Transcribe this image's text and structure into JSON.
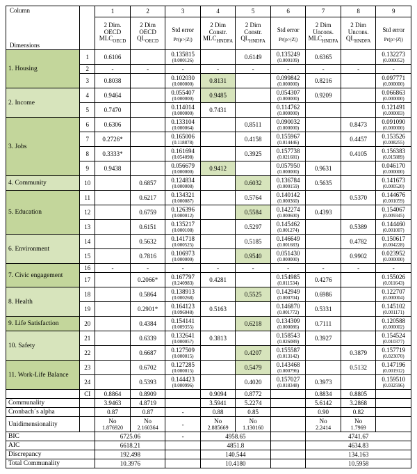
{
  "columns": {
    "nums": [
      "1",
      "2",
      "3",
      "4",
      "5",
      "6",
      "7",
      "8",
      "9"
    ],
    "left_top": "Column",
    "left_bottom": "Dimensions",
    "c1": {
      "a": "2 Dim.",
      "b": "OECD",
      "c": "MLC",
      "d": "OECD"
    },
    "c2": {
      "a": "2 Dim",
      "b": "OECD",
      "c": "QL",
      "d": "OECD"
    },
    "c3": {
      "a": "Std error",
      "b": "Pr(p>|Z|)"
    },
    "c4": {
      "a": "2 Dim",
      "b": "Constr.",
      "c": "MLC",
      "d": "HNDFA"
    },
    "c5": {
      "a": "2 Dim",
      "b": "Constr.",
      "c": "QL",
      "d": "HNDFA"
    },
    "c6": {
      "a": "Std error",
      "b": "Pr(p>|Z|)"
    },
    "c7": {
      "a": "2 Dim",
      "b": "Uncons.",
      "c": "MLC",
      "d": "HNDFA"
    },
    "c8": {
      "a": "2 Dim",
      "b": "Uncons.",
      "c": "QL",
      "d": "HNDFA"
    },
    "c9": {
      "a": "Std error",
      "b": "Pr(p>|Z|)"
    }
  },
  "dims": [
    {
      "name": "1. Housing",
      "cls": "dim-olive",
      "rows": [
        {
          "idx": "1",
          "c1": "0.6106",
          "c2": "",
          "c3": {
            "m": "0.135815",
            "s": "(0.000126)"
          },
          "c4": "",
          "c5": "0.6149",
          "c6": {
            "m": "0.135249",
            "s": "(0.000109)"
          },
          "c7": "0.6365",
          "c8": "",
          "c9": {
            "m": "0.132273",
            "s": "(0.000052)"
          }
        },
        {
          "idx": "2",
          "c1": "-",
          "c2": "-",
          "c3": "-",
          "c4": "-",
          "c5": "-",
          "c6": "-",
          "c7": "-",
          "c8": "-",
          "c9": "-"
        },
        {
          "idx": "3",
          "c1": "0.8038",
          "c2": "",
          "c3": {
            "m": "0.102030",
            "s": "(0.000000)"
          },
          "c4": "0.8131",
          "hl4": true,
          "c5": "",
          "c6": {
            "m": "0.099842",
            "s": "(0.000000)"
          },
          "c7": "0.8216",
          "c8": "",
          "c9": {
            "m": "0.097771",
            "s": "(0.000000)"
          }
        }
      ]
    },
    {
      "name": "2. Income",
      "cls": "dim-green1",
      "rows": [
        {
          "idx": "4",
          "c1": "0.9464",
          "c2": "",
          "c3": {
            "m": "0.055407",
            "s": "(0.000000)"
          },
          "c4": "0.9485",
          "hl4": true,
          "c5": "",
          "c6": {
            "m": "0.054307",
            "s": "(0.000000)"
          },
          "c7": "0.9209",
          "c8": "",
          "c9": {
            "m": "0.066863",
            "s": "(0.000000)"
          }
        },
        {
          "idx": "5",
          "c1": "0.7470",
          "c2": "",
          "c3": {
            "m": "0.114014",
            "s": "(0.000000)"
          },
          "c4": "0.7431",
          "c5": "",
          "c6": {
            "m": "0.114762",
            "s": "(0.000000)"
          },
          "c7": "",
          "c8": "",
          "c9": {
            "m": "0.121491",
            "s": "(0.000003)"
          }
        }
      ]
    },
    {
      "name": "3. Jobs",
      "cls": "dim-olive",
      "rows": [
        {
          "idx": "6",
          "c1": "0.6306",
          "c2": "",
          "c3": {
            "m": "0.133104",
            "s": "(0.000064)"
          },
          "c4": "",
          "c5": "0.8511",
          "c6": {
            "m": "0.090032",
            "s": "(0.000000)"
          },
          "c7": "",
          "c8": "0.8473",
          "c9": {
            "m": "0.091090",
            "s": "(0.000000)"
          }
        },
        {
          "idx": "7",
          "c1": "0.2726*",
          "c2": "",
          "c3": {
            "m": "0.165006",
            "s": "(0.118878)"
          },
          "c4": "",
          "c5": "0.4158",
          "c6": {
            "m": "0.155967",
            "s": "(0.014446)"
          },
          "c7": "",
          "c8": "0.4457",
          "c9": {
            "m": "0.153526",
            "s": "(0.008255)"
          }
        },
        {
          "idx": "8",
          "c1": "0.3333*",
          "c2": "",
          "c3": {
            "m": "0.161694",
            "s": "(0.054098)"
          },
          "c4": "",
          "c5": "0.3925",
          "c6": {
            "m": "0.157738",
            "s": "(0.021681)"
          },
          "c7": "",
          "c8": "0.4105",
          "c9": {
            "m": "0.156383",
            "s": "(0.015889)"
          }
        },
        {
          "idx": "9",
          "c1": "0.9438",
          "c2": "",
          "c3": {
            "m": "0.056679",
            "s": "(0.000000)"
          },
          "c4": "0.9412",
          "hl4": true,
          "c5": "",
          "c6": {
            "m": "0.057950",
            "s": "(0.000000)"
          },
          "c7": "0.9631",
          "c8": "",
          "c9": {
            "m": "0.046170",
            "s": "(0.000000)"
          }
        }
      ]
    },
    {
      "name": "4. Community",
      "cls": "dim-green2",
      "rows": [
        {
          "idx": "10",
          "c1": "",
          "c2": "0.6857",
          "c3": {
            "m": "0.124834",
            "s": "(0.000008)"
          },
          "c4": "",
          "c5": "0.6032",
          "hl5": true,
          "c6": {
            "m": "0.136784",
            "s": "(0.000159)"
          },
          "c7": "0.5635",
          "c8": "",
          "c9": {
            "m": "0.141673",
            "s": "(0.000520)"
          }
        }
      ]
    },
    {
      "name": "5. Education",
      "cls": "dim-olive",
      "rows": [
        {
          "idx": "11",
          "c1": "",
          "c2": "0.6217",
          "c3": {
            "m": "0.134321",
            "s": "(0.000087)"
          },
          "c4": "",
          "c5": "0.5764",
          "c6": {
            "m": "0.140142",
            "s": "(0.000360)"
          },
          "c7": "",
          "c8": "0.5370",
          "c9": {
            "m": "0.144676",
            "s": "(0.001059)"
          }
        },
        {
          "idx": "12",
          "c1": "",
          "c2": "0.6759",
          "c3": {
            "m": "0.126396",
            "s": "(0.000012)"
          },
          "c4": "",
          "c5": "0.5584",
          "hl5": true,
          "c6": {
            "m": "0.142274",
            "s": "(0.000600)"
          },
          "c7": "0.4393",
          "c8": "",
          "c9": {
            "m": "0.154067",
            "s": "(0.009345)"
          }
        },
        {
          "idx": "13",
          "c1": "",
          "c2": "0.6151",
          "c3": {
            "m": "0.135217",
            "s": "(0.000108)"
          },
          "c4": "",
          "c5": "0.5297",
          "c6": {
            "m": "0.145462",
            "s": "(0.001274)"
          },
          "c7": "",
          "c8": "0.5389",
          "c9": {
            "m": "0.144460",
            "s": "(0.001007)"
          }
        }
      ]
    },
    {
      "name": "6. Environment",
      "cls": "dim-green1",
      "rows": [
        {
          "idx": "14",
          "c1": "",
          "c2": "0.5632",
          "c3": {
            "m": "0.141718",
            "s": "(0.000525)"
          },
          "c4": "",
          "c5": "0.5185",
          "c6": {
            "m": "0.146649",
            "s": "(0.001683)"
          },
          "c7": "",
          "c8": "0.4782",
          "c9": {
            "m": "0.150617",
            "s": "(0.004228)"
          }
        },
        {
          "idx": "15",
          "c1": "",
          "c2": "0.7816",
          "c3": {
            "m": "0.106973",
            "s": "(0.000000)"
          },
          "c4": "",
          "c5": "0.9540",
          "hl5": true,
          "c6": {
            "m": "0.051430",
            "s": "(0.000000)"
          },
          "c7": "",
          "c8": "0.9902",
          "c9": {
            "m": "0.023952",
            "s": "(0.000000)"
          }
        }
      ]
    },
    {
      "name": "7. Civic engagement",
      "cls": "dim-olive",
      "rows": [
        {
          "idx": "16",
          "c1": "-",
          "c2": "-",
          "c3": "-",
          "c4": "-",
          "c5": "-",
          "c6": "-",
          "c7": "-",
          "c8": "-",
          "c9": "-"
        },
        {
          "idx": "17",
          "c1": "",
          "c2": "0.2066*",
          "c3": {
            "m": "0.167797",
            "s": "(0.240983)"
          },
          "c4": "0.4281",
          "c5": "",
          "c6": {
            "m": "0.154985",
            "s": "(0.011534)"
          },
          "c7": "0.4276",
          "c8": "",
          "c9": {
            "m": "0.155026",
            "s": "(0.011643)"
          }
        }
      ]
    },
    {
      "name": "8. Health",
      "cls": "dim-green1",
      "rows": [
        {
          "idx": "18",
          "c1": "",
          "c2": "0.5864",
          "c3": {
            "m": "0.138913",
            "s": "(0.000268)"
          },
          "c4": "",
          "c5": "0.5525",
          "hl5": true,
          "c6": {
            "m": "0.142949",
            "s": "(0.000704)"
          },
          "c7": "0.6986",
          "c8": "",
          "c9": {
            "m": "0.122707",
            "s": "(0.000004)"
          }
        },
        {
          "idx": "19",
          "c1": "",
          "c2": "0.2901*",
          "c3": {
            "m": "0.164123",
            "s": "(0.096048)"
          },
          "c4": "0.5163",
          "c5": "",
          "c6": {
            "m": "0.146870",
            "s": "(0.001772)"
          },
          "c7": "0.5331",
          "c8": "",
          "c9": {
            "m": "0.145102",
            "s": "(0.001171)"
          }
        }
      ]
    },
    {
      "name": "9. Life Satisfaction",
      "cls": "dim-olive",
      "rows": [
        {
          "idx": "20",
          "c1": "",
          "c2": "0.4384",
          "c3": {
            "m": "0.154141",
            "s": "(0.009355)"
          },
          "c4": "",
          "c5": "0.6218",
          "hl5": true,
          "c6": {
            "m": "0.134309",
            "s": "(0.000086)"
          },
          "c7": "0.7111",
          "c8": "",
          "c9": {
            "m": "0.120588",
            "s": "(0.000002)"
          }
        }
      ]
    },
    {
      "name": "10. Safety",
      "cls": "dim-green1",
      "rows": [
        {
          "idx": "21",
          "c1": "",
          "c2": "0.6339",
          "c3": {
            "m": "0.132641",
            "s": "(0.000057)"
          },
          "c4": "0.3813",
          "c5": "",
          "c6": {
            "m": "0.158543",
            "s": "(0.026089)"
          },
          "c7": "0.3927",
          "c8": "",
          "c9": {
            "m": "0.154524",
            "s": "(0.010377)"
          }
        },
        {
          "idx": "22",
          "c1": "",
          "c2": "0.6687",
          "c3": {
            "m": "0.127509",
            "s": "(0.000015)"
          },
          "c4": "",
          "c5": "0.4207",
          "hl5": true,
          "c6": {
            "m": "0.155587",
            "s": "(0.013142)"
          },
          "c7": "",
          "c8": "0.3879",
          "c9": {
            "m": "0.157719",
            "s": "(0.023070)"
          }
        }
      ]
    },
    {
      "name": "11. Work-Life Balance",
      "cls": "dim-olive",
      "rows": [
        {
          "idx": "23",
          "c1": "",
          "c2": "0.6702",
          "c3": {
            "m": "0.127285",
            "s": "(0.000015)"
          },
          "c4": "",
          "c5": "0.5479",
          "hl5": true,
          "c6": {
            "m": "0.143468",
            "s": "(0.000796)"
          },
          "c7": "",
          "c8": "0.5132",
          "c9": {
            "m": "0.147196",
            "s": "(0.001912)"
          }
        },
        {
          "idx": "24",
          "c1": "",
          "c2": "0.5393",
          "c3": {
            "m": "0.144423",
            "s": "(0.000996)"
          },
          "c4": "",
          "c5": "0.4020",
          "c6": {
            "m": "0.157027",
            "s": "(0.018348)"
          },
          "c7": "0.3973",
          "c8": "",
          "c9": {
            "m": "0.159510",
            "s": "(0.032596)"
          }
        }
      ]
    }
  ],
  "footer": {
    "rows": [
      {
        "label": "",
        "idx": "CI",
        "v1": "0.8864",
        "v2": "0.8909",
        "v3": "",
        "v4": "0.9094",
        "v5": "0.8772",
        "v6": "",
        "v7": "0.8834",
        "v8": "0.8805",
        "v9": ""
      },
      {
        "label": "Communality",
        "idx": "",
        "v1": "3.9463",
        "v2": "4.8719",
        "v3": "",
        "v4": "3.5941",
        "v5": "5.2274",
        "v6": "",
        "v7": "5.6142",
        "v8": "3.2868",
        "v9": ""
      },
      {
        "label": "Cronbach´s alpha",
        "idx": "",
        "v1": "0.87",
        "v2": "0.87",
        "v3": "-",
        "v4": "0.88",
        "v5": "0.85",
        "v6": "",
        "v7": "0.90",
        "v8": "0.82",
        "v9": ""
      },
      {
        "label": "Unidimensionality",
        "idx": "",
        "v1": {
          "m": "No",
          "s": "1.876920"
        },
        "v2": {
          "m": "No",
          "s": "2.160364"
        },
        "v3": "-",
        "v4": {
          "m": "No",
          "s": "2.885669"
        },
        "v5": {
          "m": "No",
          "s": "1.130160"
        },
        "v6": "",
        "v7": {
          "m": "No",
          "s": "2.2414"
        },
        "v8": {
          "m": "No",
          "s": "1.7969"
        },
        "v9": ""
      }
    ],
    "block": [
      {
        "label": "BIC",
        "g1": "6725.06",
        "g2": "-",
        "g3": "4958.65",
        "g4": "",
        "g5": "4741.67"
      },
      {
        "label": "AIC",
        "g1": "6618.21",
        "g2": "",
        "g3": "4851.8",
        "g4": "",
        "g5": "4634.83"
      },
      {
        "label": "Discrepancy",
        "g1": "192.498",
        "g2": "",
        "g3": "140.544",
        "g4": "",
        "g5": "134.163"
      },
      {
        "label": "Total Communality",
        "g1": "10.3976",
        "g2": "",
        "g3": "10.4180",
        "g4": "",
        "g5": "10.5958"
      }
    ]
  }
}
